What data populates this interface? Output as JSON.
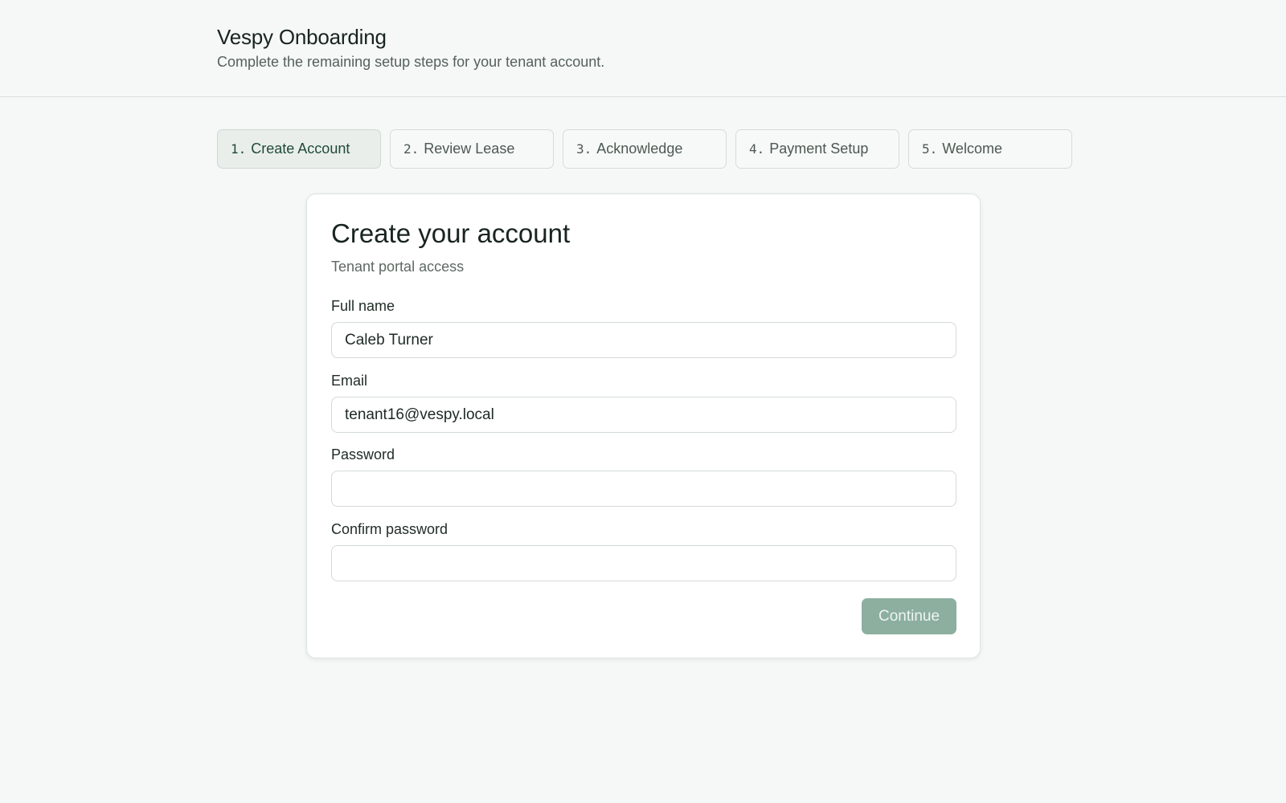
{
  "header": {
    "title": "Vespy Onboarding",
    "subtitle": "Complete the remaining setup steps for your tenant account."
  },
  "steps": [
    {
      "num": "1.",
      "label": "Create Account",
      "active": true
    },
    {
      "num": "2.",
      "label": "Review Lease",
      "active": false
    },
    {
      "num": "3.",
      "label": "Acknowledge",
      "active": false
    },
    {
      "num": "4.",
      "label": "Payment Setup",
      "active": false
    },
    {
      "num": "5.",
      "label": "Welcome",
      "active": false
    }
  ],
  "form": {
    "title": "Create your account",
    "subtitle": "Tenant portal access",
    "full_name": {
      "label": "Full name",
      "value": "Caleb Turner",
      "placeholder": ""
    },
    "email": {
      "label": "Email",
      "value": "tenant16@vespy.local",
      "placeholder": ""
    },
    "password": {
      "label": "Password",
      "value": "",
      "placeholder": ""
    },
    "confirm_password": {
      "label": "Confirm password",
      "value": "",
      "placeholder": ""
    },
    "continue_label": "Continue"
  },
  "colors": {
    "accent": "#8caf9f",
    "active_step_bg": "#e9eeeb",
    "background": "#f6f8f7"
  }
}
